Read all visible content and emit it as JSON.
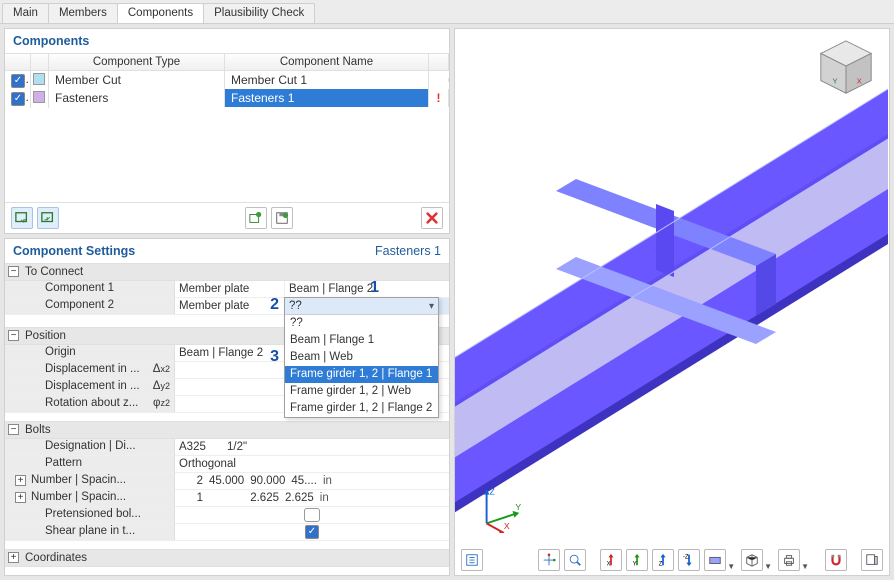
{
  "tabs": {
    "items": [
      "Main",
      "Members",
      "Components",
      "Plausibility Check"
    ],
    "active_index": 2
  },
  "components_panel": {
    "title": "Components",
    "columns": {
      "type": "Component Type",
      "name": "Component Name"
    },
    "rows": [
      {
        "checked": true,
        "swatch": "#b0e0f0",
        "type": "Member Cut",
        "name": "Member Cut 1",
        "warn": false,
        "selected": false
      },
      {
        "checked": true,
        "swatch": "#d1afe8",
        "type": "Fasteners",
        "name": "Fasteners 1",
        "warn": true,
        "selected": true
      }
    ]
  },
  "settings_panel": {
    "title": "Component Settings",
    "context": "Fasteners 1",
    "to_connect": {
      "heading": "To Connect",
      "rows": [
        {
          "label": "Component 1",
          "mid": "Member plate",
          "value": "Beam | Flange 2"
        },
        {
          "label": "Component 2",
          "mid": "Member plate",
          "value": "??",
          "dropdown_open": true
        }
      ],
      "dropdown_options": [
        "??",
        "Beam | Flange 1",
        "Beam | Web",
        "Frame girder 1, 2 | Flange 1",
        "Frame girder 1, 2 | Web",
        "Frame girder 1, 2 | Flange 2"
      ],
      "dropdown_selected_index": 3
    },
    "position": {
      "heading": "Position",
      "rows": [
        {
          "label": "Origin",
          "value": "Beam | Flange 2"
        },
        {
          "label": "Displacement in ...",
          "sym": "Δx2",
          "value": ""
        },
        {
          "label": "Displacement in ...",
          "sym": "Δy2",
          "value": ""
        },
        {
          "label": "Rotation about z...",
          "sym": "φz2",
          "value": ""
        }
      ]
    },
    "bolts": {
      "heading": "Bolts",
      "rows": [
        {
          "label": "Designation | Di...",
          "col1": "A325",
          "col2": "1/2\""
        },
        {
          "label": "Pattern",
          "col1": "Orthogonal"
        },
        {
          "label": "Number | Spacin...",
          "expandable": true,
          "col1": "2",
          "col2": "45.000",
          "col3": "90.000",
          "col4": "45....",
          "unit": "in"
        },
        {
          "label": "Number | Spacin...",
          "expandable": true,
          "col1": "1",
          "col2": "",
          "col3": "2.625",
          "col4": "2.625",
          "unit": "in"
        },
        {
          "label": "Pretensioned bol...",
          "checkbox": true,
          "checked": false
        },
        {
          "label": "Shear plane in t...",
          "checkbox": true,
          "checked": true
        }
      ]
    },
    "coordinates": {
      "heading": "Coordinates"
    }
  },
  "annotations": {
    "one": "1",
    "two": "2",
    "three": "3"
  },
  "axes": {
    "x": "X",
    "y": "Y",
    "z": "Z"
  }
}
